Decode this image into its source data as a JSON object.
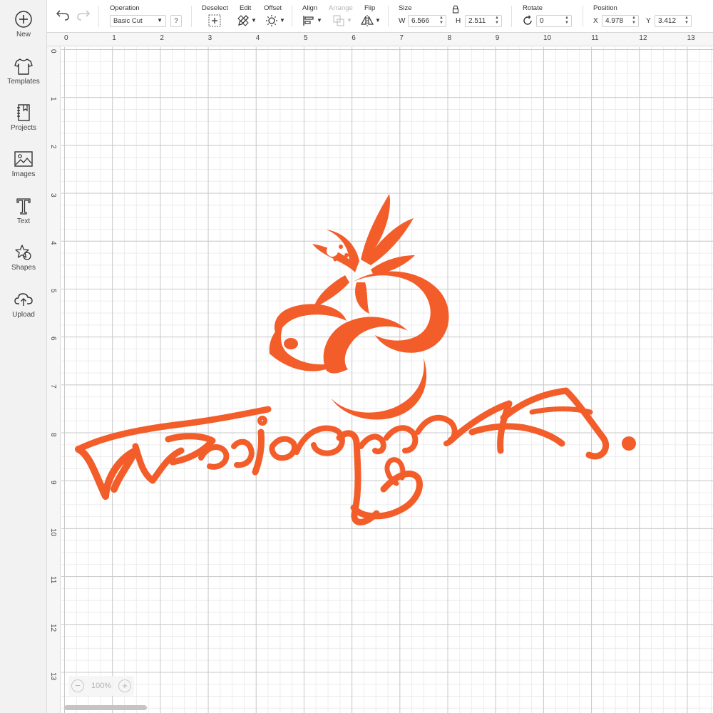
{
  "sidebar": {
    "new_label": "New",
    "templates_label": "Templates",
    "projects_label": "Projects",
    "images_label": "Images",
    "text_label": "Text",
    "shapes_label": "Shapes",
    "upload_label": "Upload"
  },
  "toolbar": {
    "operation_label": "Operation",
    "operation_value": "Basic Cut",
    "operation_help": "?",
    "deselect_label": "Deselect",
    "edit_label": "Edit",
    "offset_label": "Offset",
    "align_label": "Align",
    "arrange_label": "Arrange",
    "flip_label": "Flip",
    "size_label": "Size",
    "width_prefix": "W",
    "width_value": "6.566",
    "height_prefix": "H",
    "height_value": "2.511",
    "rotate_label": "Rotate",
    "rotate_value": "0",
    "position_label": "Position",
    "x_prefix": "X",
    "x_value": "4.978",
    "y_prefix": "Y",
    "y_value": "3.412"
  },
  "ruler": {
    "top": [
      "0",
      "1",
      "2",
      "3",
      "4",
      "5",
      "6",
      "7",
      "8",
      "9",
      "10",
      "11",
      "12",
      "13"
    ],
    "left": [
      "0",
      "1",
      "2",
      "3",
      "4",
      "5",
      "6",
      "7",
      "8",
      "9",
      "10",
      "11",
      "12",
      "13"
    ]
  },
  "zoom": {
    "level": "100%",
    "minus": "−",
    "plus": "+"
  },
  "colors": {
    "design": "#f25d2a",
    "grid_major": "#c9c9c9",
    "grid_minor": "#ececec"
  }
}
